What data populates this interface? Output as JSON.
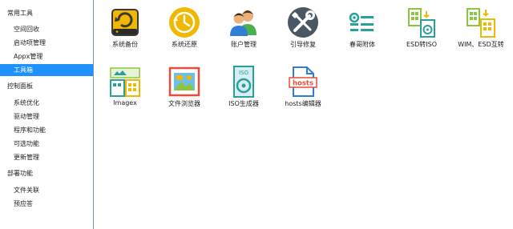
{
  "sidebar": {
    "groups": [
      {
        "title": "常用工具",
        "items": [
          "空间回收",
          "启动项管理",
          "Appx管理",
          "工具箱"
        ]
      },
      {
        "title": "控制面板",
        "items": [
          "系统优化",
          "驱动管理",
          "程序和功能",
          "可选功能",
          "更新管理"
        ]
      },
      {
        "title": "部署功能",
        "items": [
          "文件关联",
          "预应答"
        ]
      }
    ],
    "active_item": "工具箱"
  },
  "tools": [
    {
      "label": "系统备份",
      "icon": "backup-icon"
    },
    {
      "label": "系统还原",
      "icon": "restore-clock-icon"
    },
    {
      "label": "账户管理",
      "icon": "users-icon"
    },
    {
      "label": "引导修复",
      "icon": "wrench-screwdriver-icon"
    },
    {
      "label": "春哥附体",
      "icon": "toggle-options-icon"
    },
    {
      "label": "ESD转ISO",
      "icon": "esd-to-iso-icon"
    },
    {
      "label": "WIM、ESD互转",
      "icon": "wim-esd-convert-icon"
    },
    {
      "label": "Imagex",
      "icon": "imagex-icon"
    },
    {
      "label": "文件浏览器",
      "icon": "file-explorer-icon"
    },
    {
      "label": "ISO生成器",
      "icon": "iso-generator-icon"
    },
    {
      "label": "hosts编辑器",
      "icon": "hosts-editor-icon"
    }
  ],
  "icon_text": {
    "iso": "ISO",
    "hosts": "hosts"
  },
  "colors": {
    "accent": "#1e90ff",
    "sidebar_border": "#7a98c4",
    "yellow": "#f0b800",
    "green": "#8cc63f",
    "teal": "#2aa198"
  }
}
